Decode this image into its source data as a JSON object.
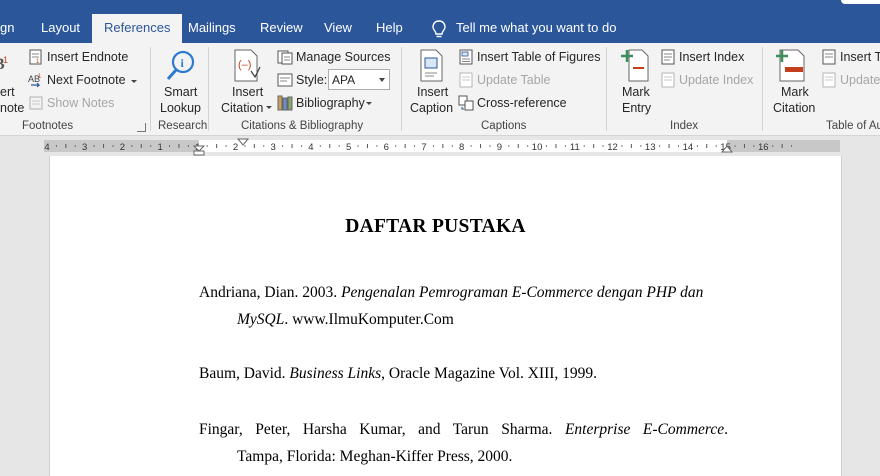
{
  "tabs": {
    "partial": "gn",
    "layout": "Layout",
    "references": "References",
    "mailings": "Mailings",
    "review": "Review",
    "view": "View",
    "help": "Help",
    "tell_me": "Tell me what you want to do"
  },
  "ribbon": {
    "footnotes": {
      "insert_footnote_top": "ert",
      "insert_footnote_bottom": "note",
      "insert_endnote": "Insert Endnote",
      "next_footnote": "Next Footnote",
      "show_notes": "Show Notes",
      "group": "Footnotes"
    },
    "research": {
      "smart_lookup_1": "Smart",
      "smart_lookup_2": "Lookup",
      "group": "Research"
    },
    "citations": {
      "insert_citation_1": "Insert",
      "insert_citation_2": "Citation",
      "manage_sources": "Manage Sources",
      "style_label": "Style:",
      "style_value": "APA",
      "bibliography": "Bibliography",
      "group": "Citations & Bibliography"
    },
    "captions": {
      "insert_caption_1": "Insert",
      "insert_caption_2": "Caption",
      "insert_table_of_figures": "Insert Table of Figures",
      "update_table": "Update Table",
      "cross_reference": "Cross-reference",
      "group": "Captions"
    },
    "index": {
      "mark_entry_1": "Mark",
      "mark_entry_2": "Entry",
      "insert_index": "Insert Index",
      "update_index": "Update Index",
      "group": "Index"
    },
    "authorities": {
      "mark_citation_1": "Mark",
      "mark_citation_2": "Citation",
      "insert_partial": "Insert Ta",
      "update_partial": "Update",
      "group": "Table of Au"
    }
  },
  "ruler": {
    "labels": [
      "4",
      "3",
      "2",
      "1",
      "1",
      "2",
      "3",
      "4",
      "5",
      "6",
      "7",
      "8",
      "9",
      "10",
      "11",
      "12",
      "13",
      "14",
      "15",
      "16"
    ]
  },
  "document": {
    "title": "DAFTAR PUSTAKA",
    "refs": [
      {
        "a": "Andriana, Dian. 2003. ",
        "b": "Pengenalan Pemrograman E-Commerce dengan PHP dan",
        "c": "MySQL",
        "d": ". www.IlmuKomputer.Com"
      },
      {
        "a": "Baum, David. ",
        "b": "Business Links",
        "c": ", Oracle Magazine Vol. XIII, 1999."
      },
      {
        "a": "Fingar, Peter, Harsha Kumar, and Tarun Sharma. ",
        "b": "Enterprise E-Commerce",
        "c": ".",
        "d": "Tampa, Florida: Meghan-Kiffer Press, 2000."
      }
    ]
  },
  "colors": {
    "accent": "#2b579a",
    "ribbon": "#f3f3f3",
    "canvas": "#e6e6e6"
  }
}
